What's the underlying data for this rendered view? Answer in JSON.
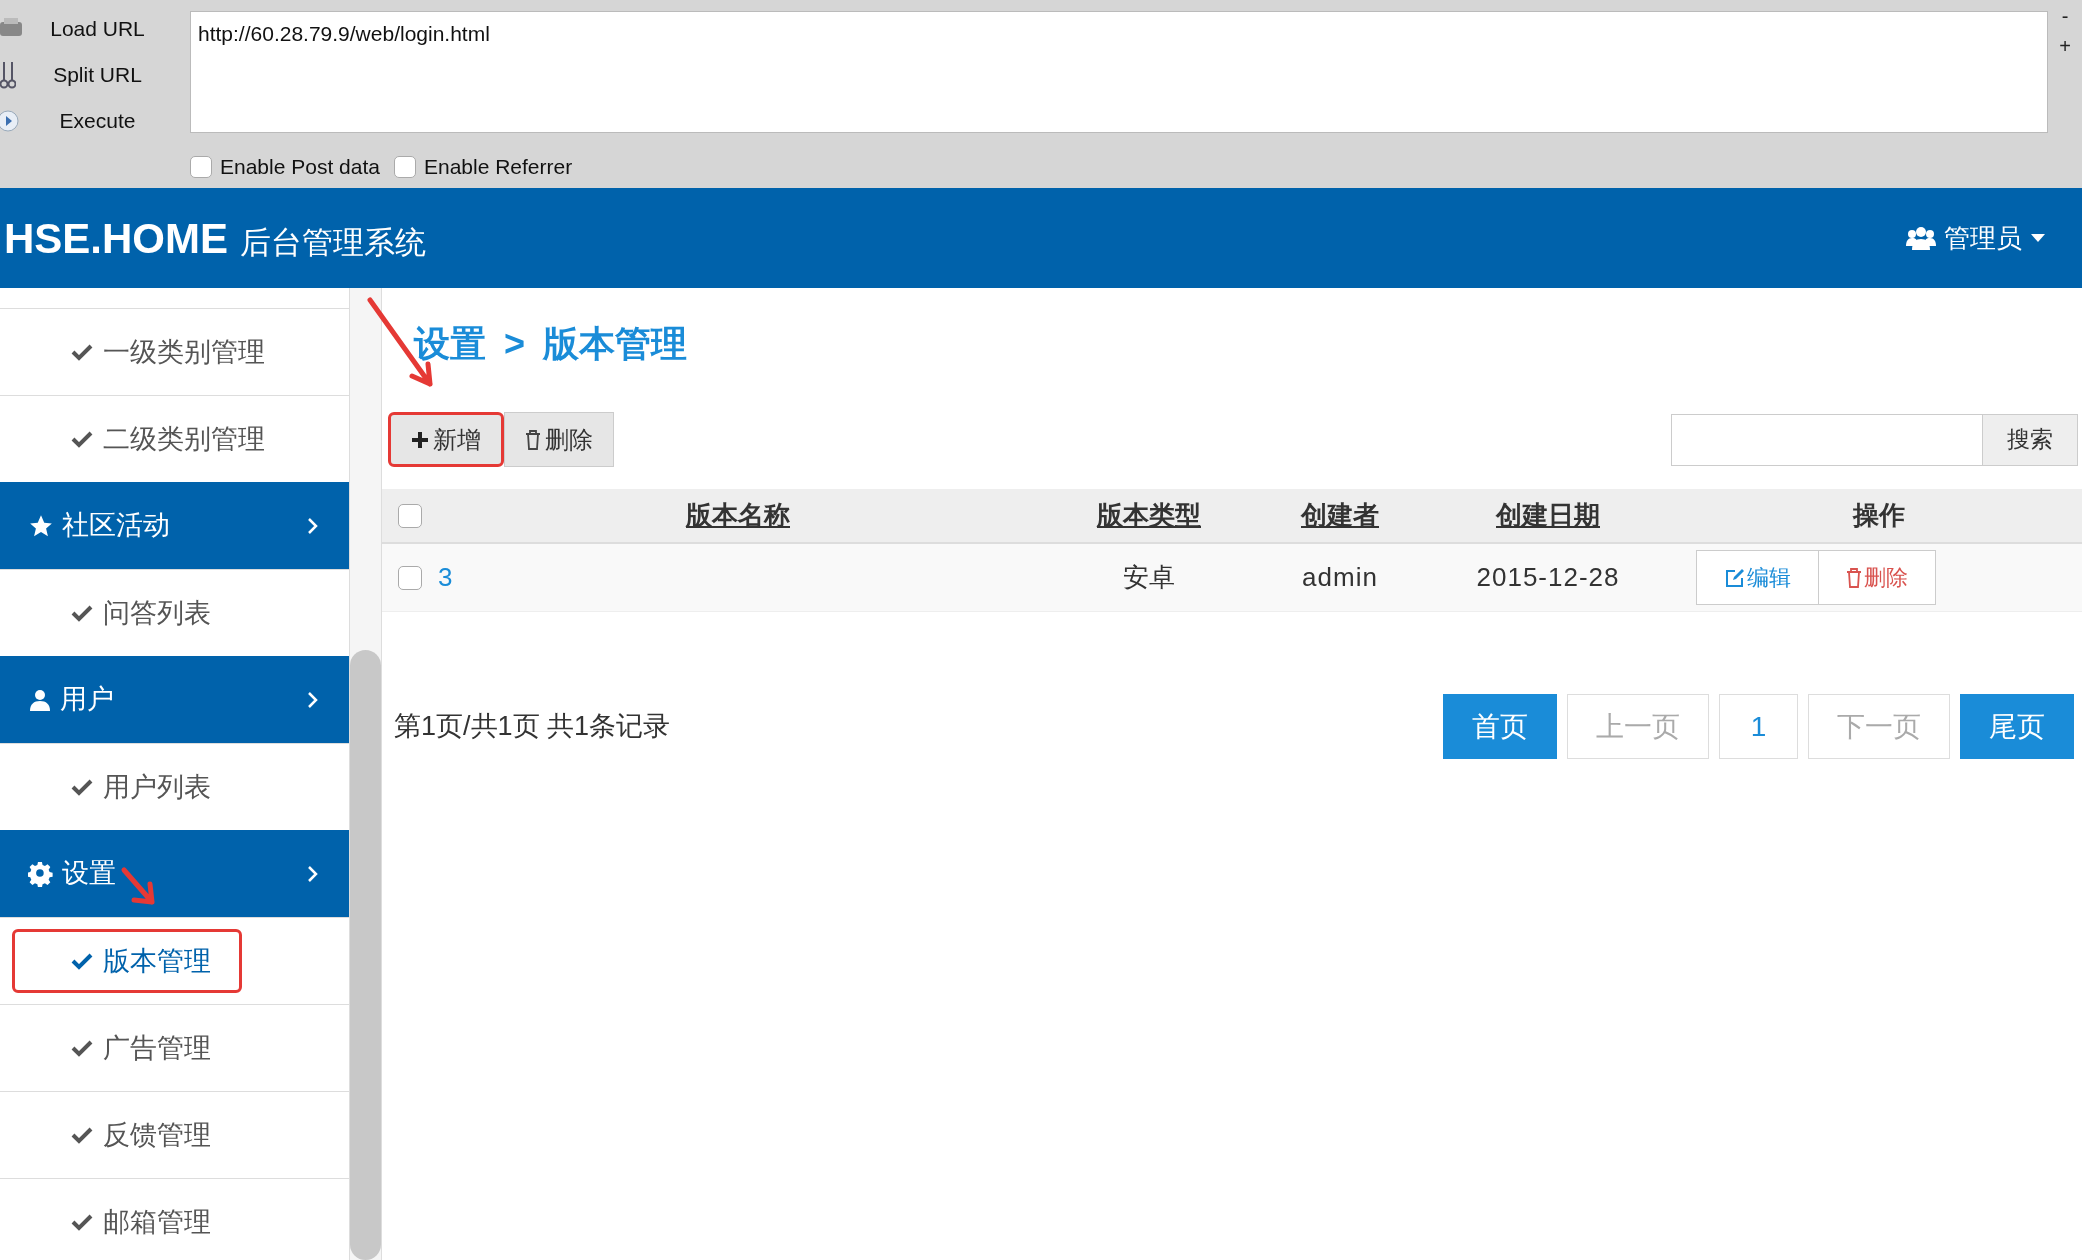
{
  "toolbar": {
    "actions": [
      {
        "label": "Load URL"
      },
      {
        "label": "Split URL"
      },
      {
        "label": "Execute"
      }
    ],
    "url": "http://60.28.79.9/web/login.html",
    "side_buttons": [
      "-",
      "+"
    ],
    "options": [
      {
        "label": "Enable Post data",
        "checked": false
      },
      {
        "label": "Enable Referrer",
        "checked": false
      }
    ]
  },
  "header": {
    "brand": "HSE.HOME",
    "subtitle": "后台管理系统",
    "user": "管理员"
  },
  "sidebar": {
    "items": [
      {
        "kind": "item",
        "label": "一级类别管理",
        "selected": false
      },
      {
        "kind": "item",
        "label": "二级类别管理",
        "selected": false
      },
      {
        "kind": "group",
        "label": "社区活动"
      },
      {
        "kind": "item",
        "label": "问答列表",
        "selected": false
      },
      {
        "kind": "group",
        "label": "用户"
      },
      {
        "kind": "item",
        "label": "用户列表",
        "selected": false
      },
      {
        "kind": "group",
        "label": "设置"
      },
      {
        "kind": "item",
        "label": "版本管理",
        "selected": true
      },
      {
        "kind": "item",
        "label": "广告管理",
        "selected": false
      },
      {
        "kind": "item",
        "label": "反馈管理",
        "selected": false
      },
      {
        "kind": "item",
        "label": "邮箱管理",
        "selected": false
      }
    ]
  },
  "breadcrumb": [
    "设置",
    ">",
    "版本管理"
  ],
  "actions": [
    {
      "kind": "add",
      "label": "新增"
    },
    {
      "kind": "delete",
      "label": "删除"
    }
  ],
  "search": {
    "button": "搜索"
  },
  "table": {
    "header_checked": false,
    "columns": [
      "版本名称",
      "版本类型",
      "创建者",
      "创建日期",
      "操作"
    ],
    "rows": [
      {
        "checked": false,
        "name": "3",
        "type": "安卓",
        "creator": "admin",
        "date": "2015-12-28",
        "edit": "编辑",
        "delete": "删除"
      }
    ]
  },
  "pagination": {
    "summary": "第1页/共1页 共1条记录",
    "buttons": [
      {
        "kind": "nav",
        "label": "首页",
        "disabled": false
      },
      {
        "kind": "nav",
        "label": "上一页",
        "disabled": true
      },
      {
        "kind": "page",
        "label": "1",
        "selected": true
      },
      {
        "kind": "nav",
        "label": "下一页",
        "disabled": true
      },
      {
        "kind": "nav",
        "label": "尾页",
        "disabled": false
      }
    ]
  }
}
